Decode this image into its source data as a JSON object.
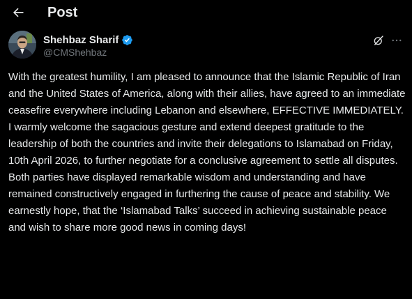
{
  "header": {
    "back_icon": "arrow-left-icon",
    "title": "Post"
  },
  "author": {
    "display_name": "Shehbaz Sharif",
    "handle": "@CMShehbaz",
    "verified_icon": "verified-badge-icon",
    "verified_color": "#1d9bf0",
    "grok_icon": "grok-icon",
    "more_icon": "more-horizontal-icon"
  },
  "post": {
    "paragraphs": [
      "With the greatest humility, I am pleased to announce that the Islamic Republic of Iran and the United States of America, along with their allies, have agreed to an immediate ceasefire everywhere including Lebanon and elsewhere, EFFECTIVE IMMEDIATELY.",
      "I warmly welcome the sagacious gesture and extend deepest gratitude to the leadership of both the countries and invite their delegations to Islamabad on Friday, 10th April 2026, to further negotiate for a conclusive agreement to settle all disputes.",
      "Both parties have displayed remarkable wisdom and understanding and have remained constructively engaged in furthering the cause of peace and stability. We earnestly hope, that the ‘Islamabad Talks’ succeed in achieving sustainable peace and wish to share more good news in coming days!"
    ]
  },
  "colors": {
    "background": "#000000",
    "text_primary": "#e7e9ea",
    "text_secondary": "#71767b",
    "accent": "#1d9bf0"
  }
}
